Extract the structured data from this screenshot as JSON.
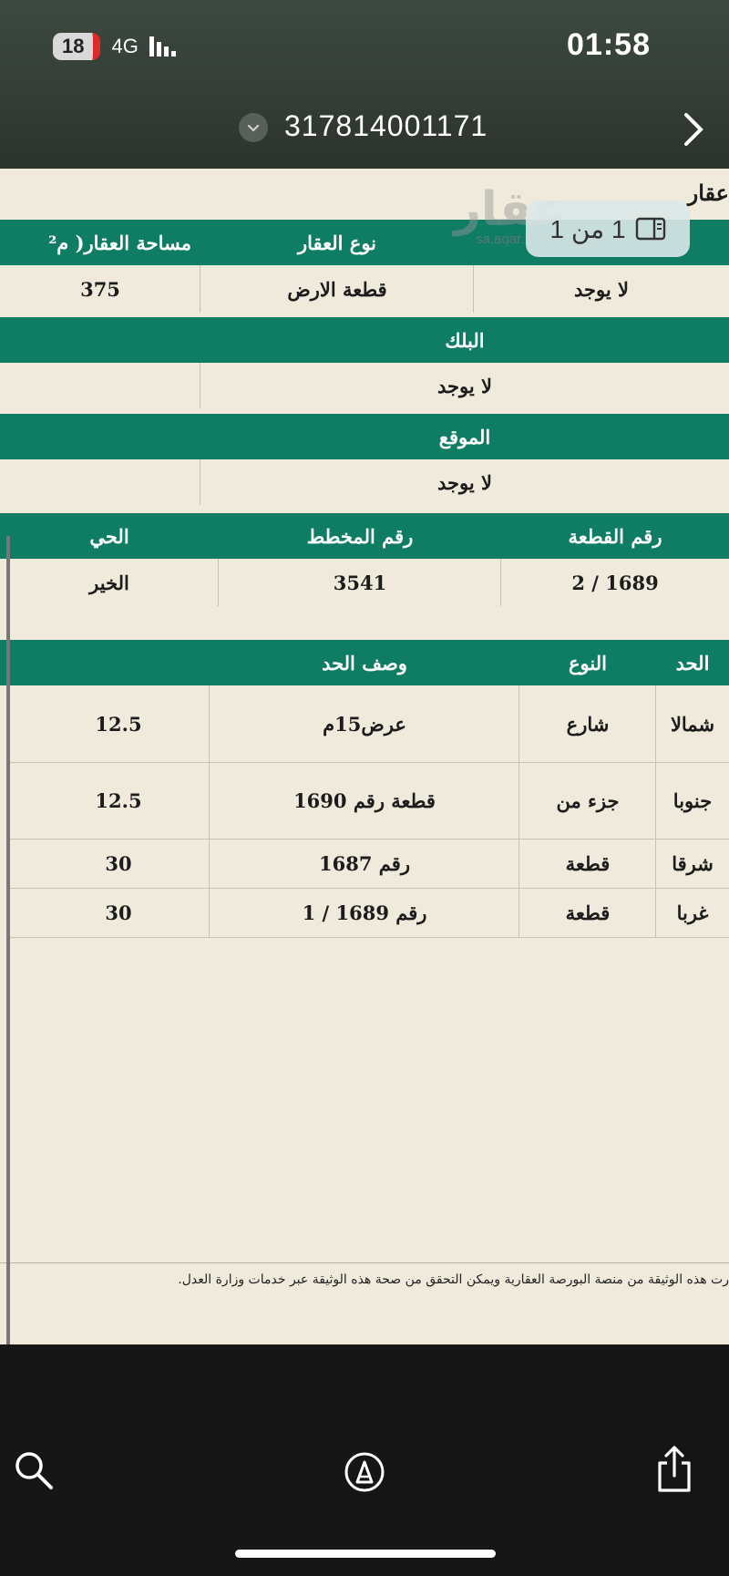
{
  "status_bar": {
    "battery": "18",
    "network": "4G",
    "time": "01:58"
  },
  "title_bar": {
    "document_number": "317814001171"
  },
  "page_indicator": {
    "text": "1 من 1"
  },
  "watermark": {
    "logo": "عقار",
    "url": "sa.aqar.fm"
  },
  "document": {
    "heading": "عقار",
    "property_table": {
      "headers": [
        "",
        "نوع العقار",
        "مساحة العقار( م²"
      ],
      "values": [
        "لا يوجد",
        "قطعة الارض",
        "375"
      ]
    },
    "block": {
      "label": "البلك",
      "value": "لا يوجد"
    },
    "location": {
      "label": "الموقع",
      "value": "لا يوجد"
    },
    "plot_table": {
      "headers": [
        "رقم القطعة",
        "رقم المخطط",
        "الحي"
      ],
      "values": [
        "2 / 1689",
        "3541",
        "الخير"
      ]
    },
    "boundaries": {
      "headers": [
        "الحد",
        "النوع",
        "وصف الحد",
        ""
      ],
      "rows": [
        [
          "شمالا",
          "شارع",
          "عرض15م",
          "12.5"
        ],
        [
          "جنوبا",
          "جزء من",
          "قطعة رقم 1690",
          "12.5"
        ],
        [
          "شرقا",
          "قطعة",
          "رقم 1687",
          "30"
        ],
        [
          "غربا",
          "قطعة",
          "رقم 1689 / 1",
          "30"
        ]
      ]
    },
    "footer_note": "رت هذه الوثيقة من منصة البورصة العقارية ويمكن التحقق من صحة هذه الوثيقة عبر خدمات وزارة العدل."
  },
  "toolbar": {
    "search": "search-icon",
    "markup": "markup-icon",
    "share": "share-icon"
  }
}
